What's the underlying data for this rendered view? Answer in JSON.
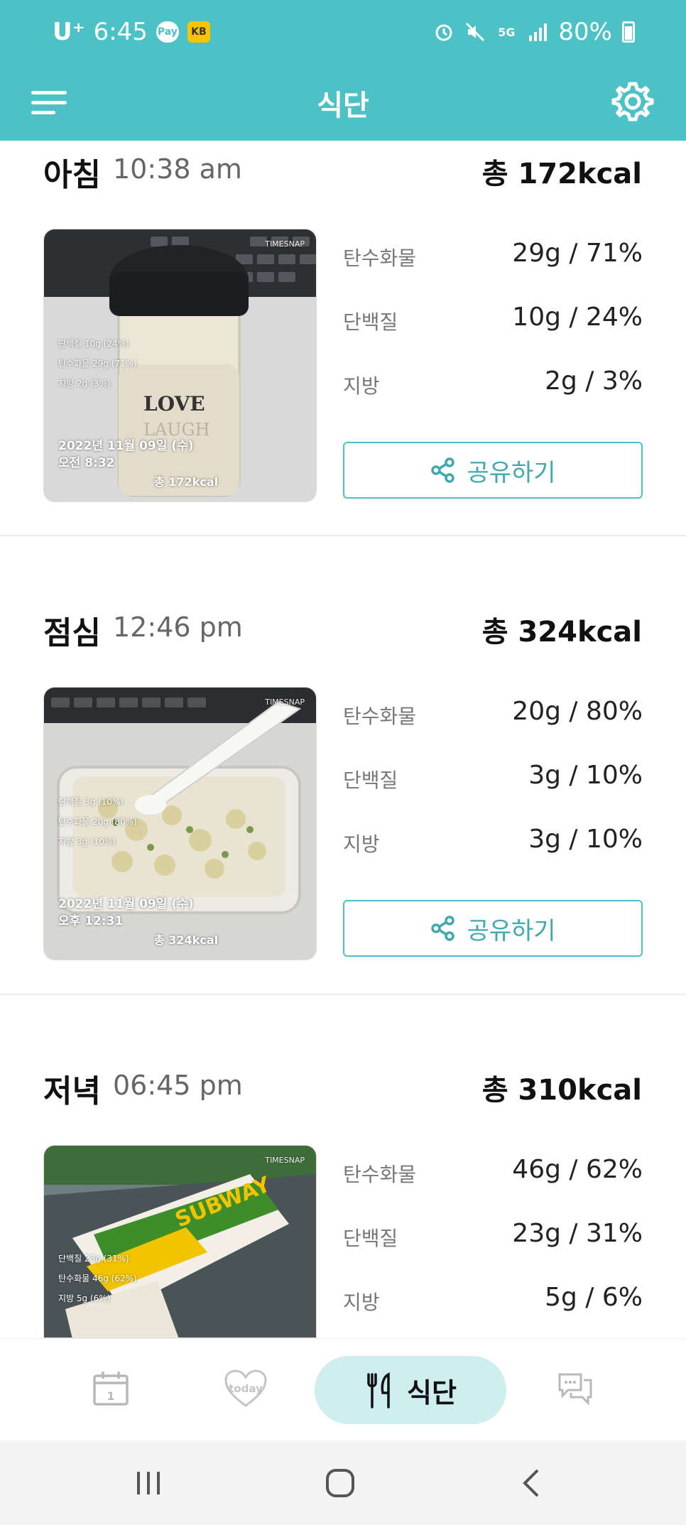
{
  "status_bar": {
    "carrier": "U⁺",
    "time": "6:45",
    "pay_badge": "Pay",
    "battery": "80%"
  },
  "app_bar": {
    "title": "식단"
  },
  "meals": [
    {
      "name": "아침",
      "time": "10:38 am",
      "total": "총 172kcal",
      "nutrients": [
        {
          "label": "탄수화물",
          "value": "29g / 71%"
        },
        {
          "label": "단백질",
          "value": "10g / 24%"
        },
        {
          "label": "지방",
          "value": "2g / 3%"
        }
      ],
      "photo": {
        "overlay_lines": [
          "단백질 10g (24%)",
          "탄수화물 29g (71%)",
          "지방 2g (3%)"
        ],
        "date": "2022년 11월 09일 (수)",
        "clock": "오전 8:32",
        "kcal": "총 172kcal",
        "brand": "TIMESNAP"
      },
      "share_label": "공유하기"
    },
    {
      "name": "점심",
      "time": "12:46 pm",
      "total": "총 324kcal",
      "nutrients": [
        {
          "label": "탄수화물",
          "value": "20g / 80%"
        },
        {
          "label": "단백질",
          "value": "3g / 10%"
        },
        {
          "label": "지방",
          "value": "3g / 10%"
        }
      ],
      "photo": {
        "overlay_lines": [
          "단백질 3g (10%)",
          "탄수화물 20g (80%)",
          "지방 3g (10%)"
        ],
        "date": "2022년 11월 09일 (수)",
        "clock": "오후 12:31",
        "kcal": "총 324kcal",
        "brand": "TIMESNAP"
      },
      "share_label": "공유하기"
    },
    {
      "name": "저녁",
      "time": "06:45 pm",
      "total": "총 310kcal",
      "nutrients": [
        {
          "label": "탄수화물",
          "value": "46g / 62%"
        },
        {
          "label": "단백질",
          "value": "23g / 31%"
        },
        {
          "label": "지방",
          "value": "5g / 6%"
        }
      ],
      "photo": {
        "overlay_lines": [
          "단백질 23g (31%)",
          "탄수화물 46g (62%)",
          "지방 5g (6%)"
        ],
        "brand": "TIMESNAP"
      }
    }
  ],
  "bottom_nav": {
    "items": [
      {
        "name": "calendar-icon"
      },
      {
        "name": "today-heart-icon",
        "label": "today"
      },
      {
        "name": "meal-fork-knife-icon",
        "label": "식단",
        "active": true
      },
      {
        "name": "chat-icon"
      }
    ]
  },
  "colors": {
    "accent": "#4cc1c6",
    "active_nav_bg": "#cfeef0"
  }
}
